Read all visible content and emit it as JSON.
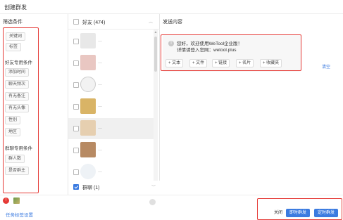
{
  "window": {
    "title": "创建群发"
  },
  "filters": {
    "header": "筛选条件",
    "general": [
      {
        "label": "关键词"
      },
      {
        "label": "标签"
      }
    ],
    "friend_section": "好友专用条件",
    "friend": [
      {
        "label": "添加时间"
      },
      {
        "label": "聊天频次"
      },
      {
        "label": "有无备注"
      },
      {
        "label": "有无头像"
      },
      {
        "label": "性别"
      },
      {
        "label": "地区"
      }
    ],
    "group_section": "群聊专用条件",
    "group": [
      {
        "label": "群人数"
      },
      {
        "label": "是否群主"
      }
    ]
  },
  "list": {
    "friends_header": "好友 (474)",
    "rows": [
      {
        "name": "…",
        "avatar_color": "#e8e8e8",
        "avatar_type": "blank",
        "selected": false
      },
      {
        "name": "…",
        "avatar_color": "#e9c7c2",
        "avatar_type": "photo",
        "selected": false
      },
      {
        "name": "…",
        "avatar_color": "#f2f2f2",
        "avatar_type": "skull",
        "selected": false
      },
      {
        "name": "…",
        "avatar_color": "#d9b466",
        "avatar_type": "dog",
        "selected": false
      },
      {
        "name": "…",
        "avatar_color": "#e6cfb0",
        "avatar_type": "photo",
        "selected": true
      },
      {
        "name": "…",
        "avatar_color": "#b78a63",
        "avatar_type": "photo",
        "selected": false
      },
      {
        "name": "…",
        "avatar_color": "#eef2f6",
        "avatar_type": "icon",
        "selected": false
      }
    ],
    "groups_header": "群聊 (1)",
    "groups_checked": true
  },
  "content": {
    "header": "发送内容",
    "message_line1": "您好，欢迎使用WeTool企业版！",
    "message_line2": "详情请登入官网：wetool.plus",
    "add_buttons": [
      {
        "label": "+ 文本"
      },
      {
        "label": "+ 文件"
      },
      {
        "label": "+ 链接"
      },
      {
        "label": "+ 名片"
      },
      {
        "label": "+ 收藏夹"
      }
    ],
    "clear_label": "清空"
  },
  "footer": {
    "badge": "!",
    "task_link": "任务标签设置",
    "close_label": "关闭",
    "send_now_label": "即时群发",
    "schedule_label": "定时群发"
  },
  "colors": {
    "accent": "#3b7be0",
    "highlight_border": "#e53935"
  }
}
